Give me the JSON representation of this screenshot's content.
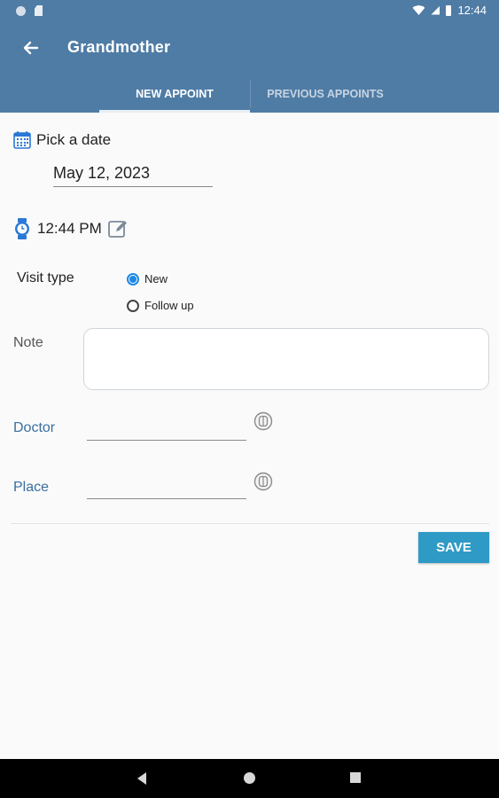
{
  "status_bar": {
    "time": "12:44"
  },
  "app_bar": {
    "title": "Grandmother"
  },
  "tabs": [
    {
      "label": "NEW APPOINT"
    },
    {
      "label": "PREVIOUS APPOINTS"
    }
  ],
  "form": {
    "pick_date_label": "Pick a date",
    "date_value": "May 12, 2023",
    "time_value": "12:44 PM",
    "visit_type_label": "Visit type",
    "visit_options": [
      {
        "label": "New",
        "selected": true
      },
      {
        "label": "Follow up",
        "selected": false
      }
    ],
    "note_label": "Note",
    "note_value": "",
    "doctor_label": "Doctor",
    "doctor_value": "",
    "place_label": "Place",
    "place_value": "",
    "save_label": "SAVE"
  },
  "colors": {
    "app_bar": "#4f7ca5",
    "accent": "#1e88e5",
    "save_button": "#2f9ac6",
    "field_label": "#3a6ea0"
  },
  "icons": [
    "back-arrow-icon",
    "calendar-icon",
    "watch-icon",
    "edit-icon",
    "contact-picker-icon"
  ]
}
